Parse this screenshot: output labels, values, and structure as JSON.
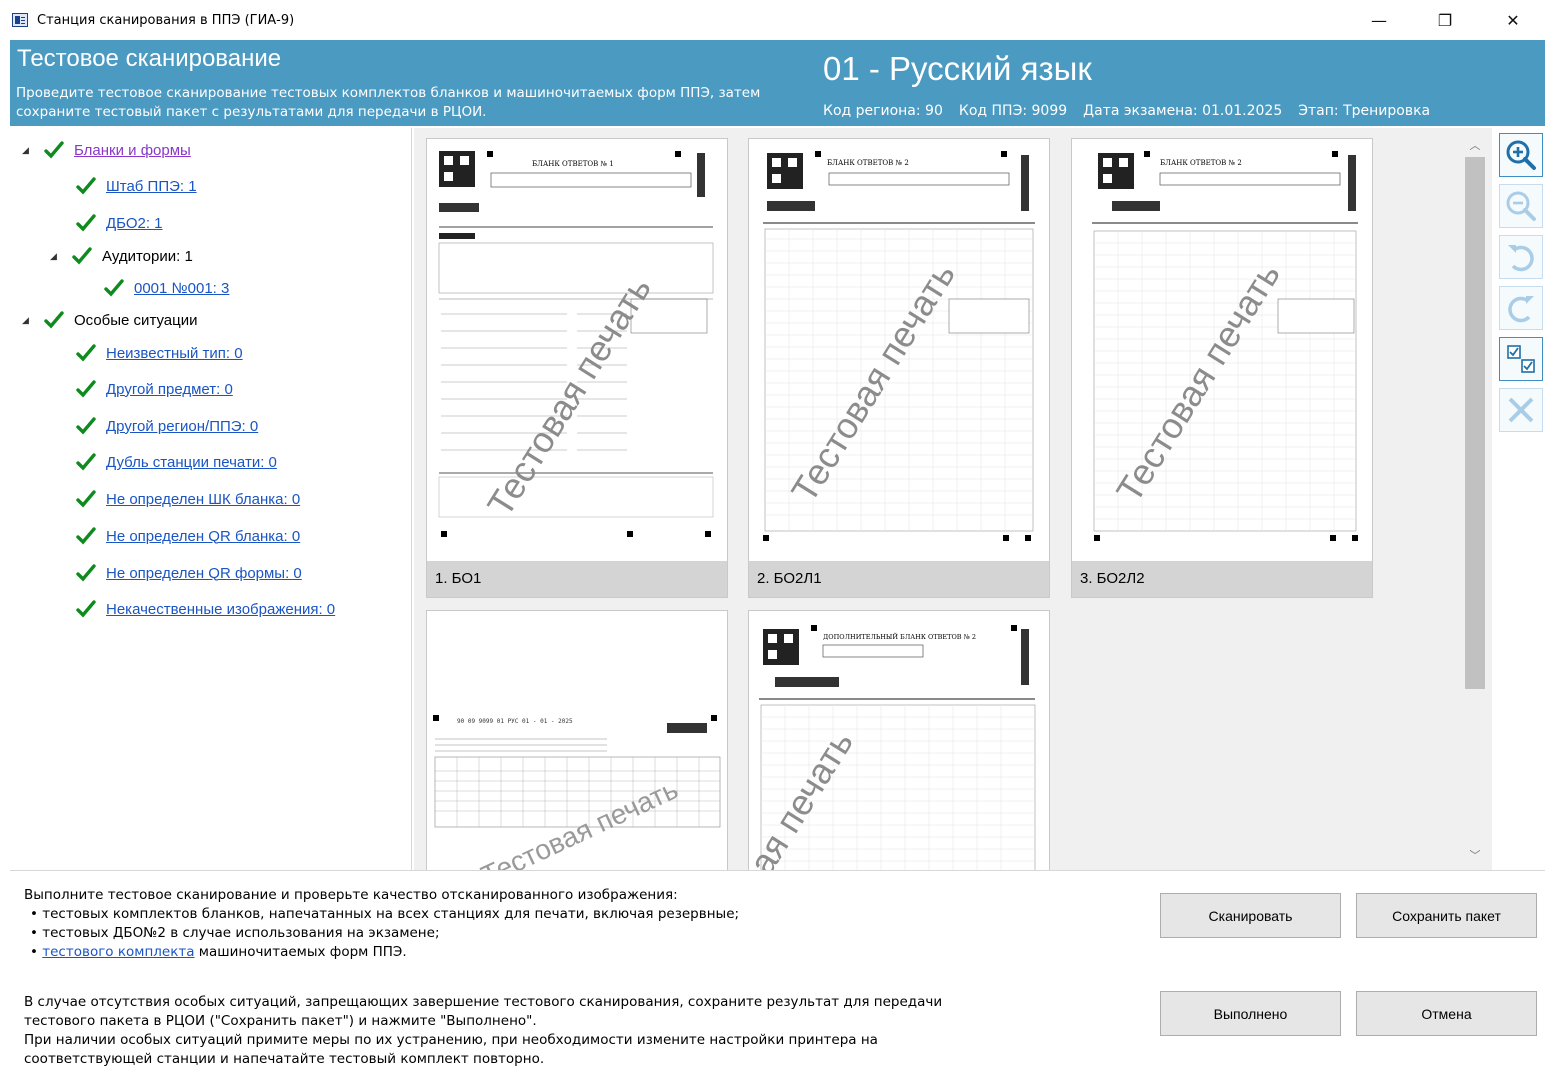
{
  "window": {
    "title": "Станция сканирования в ППЭ (ГИА-9)",
    "minimize_glyph": "—",
    "maximize_glyph": "❐",
    "close_glyph": "✕"
  },
  "header": {
    "title": "Тестовое сканирование",
    "description": "Проведите тестовое сканирование тестовых комплектов бланков и машиночитаемых форм ППЭ, затем сохраните тестовый пакет с результатами для передачи в РЦОИ.",
    "subject": "01 - Русский язык",
    "region": "Код региона: 90",
    "ppe": "Код ППЭ: 9099",
    "exam_date": "Дата экзамена: 01.01.2025",
    "stage": "Этап: Тренировка",
    "background_color": "#4a9ac2"
  },
  "tree": {
    "check_color": "#0f8a1f",
    "items": [
      {
        "label": "Бланки и формы",
        "expanded": true,
        "link": true
      },
      {
        "label": "Штаб ППЭ: 1",
        "link": true
      },
      {
        "label": "ДБО2: 1",
        "link": true
      },
      {
        "label": "Аудитории: 1",
        "expanded": true,
        "link": false
      },
      {
        "label": "0001 №001: 3",
        "link": true
      },
      {
        "label": "Особые ситуации",
        "expanded": true,
        "link": false
      },
      {
        "label": "Неизвестный тип: 0",
        "link": true
      },
      {
        "label": "Другой предмет: 0",
        "link": true
      },
      {
        "label": "Другой регион/ППЭ: 0",
        "link": true
      },
      {
        "label": "Дубль станции печати: 0",
        "link": true
      },
      {
        "label": "Не определен ШК бланка: 0",
        "link": true
      },
      {
        "label": "Не определен QR бланка: 0",
        "link": true
      },
      {
        "label": "Не определен QR формы: 0",
        "link": true
      },
      {
        "label": "Некачественные изображения: 0",
        "link": true
      }
    ]
  },
  "gallery": {
    "watermark": "Тестовая печать",
    "cards": [
      {
        "caption": "1. БО1",
        "form_title": "БЛАНК ОТВЕТОВ № 1"
      },
      {
        "caption": "2. БО2Л1",
        "form_title": "БЛАНК ОТВЕТОВ № 2"
      },
      {
        "caption": "3. БО2Л2",
        "form_title": "БЛАНК ОТВЕТОВ № 2"
      },
      {
        "caption": "",
        "form_title": ""
      },
      {
        "caption": "",
        "form_title": "ДОПОЛНИТЕЛЬНЫЙ БЛАНК ОТВЕТОВ № 2"
      }
    ]
  },
  "toolbar": {
    "zoom_in": "zoom-in-icon",
    "zoom_out": "zoom-out-icon",
    "rotate_left": "rotate-left-icon",
    "rotate_right": "rotate-right-icon",
    "check_all": "check-list-icon",
    "delete": "delete-icon"
  },
  "instructions": {
    "intro": "Выполните тестовое сканирование и проверьте качество отсканированного изображения:",
    "bullet1": "тестовых комплектов бланков, напечатанных на всех станциях для печати, включая резервные;",
    "bullet2": "тестовых ДБО№2 в случае использования на экзамене;",
    "bullet3_link": "тестового комплекта",
    "bullet3_rest": " машиночитаемых форм ППЭ.",
    "para2_line1": "В случае отсутствия особых ситуаций, запрещающих завершение тестового сканирования, сохраните результат для передачи",
    "para2_line2": "тестового пакета в РЦОИ (\"Сохранить пакет\") и нажмите \"Выполнено\".",
    "para2_line3": "При наличии особых ситуаций примите меры по их устранению, при необходимости измените настройки принтера на",
    "para2_line4": "соответствующей станции и напечатайте тестовый комплект повторно."
  },
  "buttons": {
    "scan": "Сканировать",
    "save": "Сохранить пакет",
    "done": "Выполнено",
    "cancel": "Отмена"
  }
}
